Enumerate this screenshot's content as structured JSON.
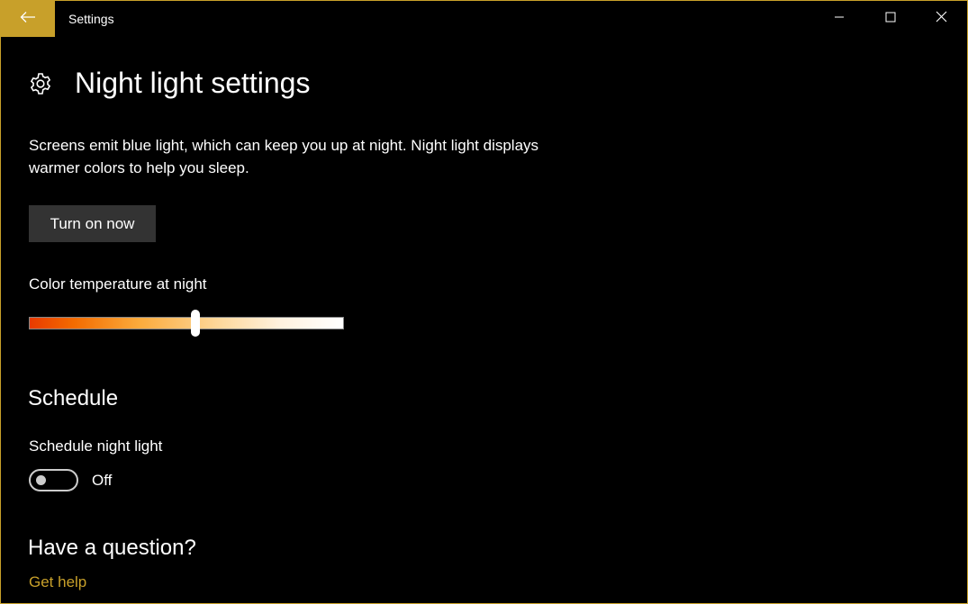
{
  "window": {
    "app_title": "Settings",
    "accent_color": "#c8a02a",
    "controls": {
      "minimize_icon": "minimize-icon",
      "maximize_icon": "maximize-icon",
      "close_icon": "close-icon"
    }
  },
  "header": {
    "back_icon": "back-arrow-icon",
    "page_icon": "gear-icon",
    "title": "Night light settings"
  },
  "main": {
    "description": "Screens emit blue light, which can keep you up at night. Night light displays warmer colors to help you sleep.",
    "turn_on_button": "Turn on now",
    "color_temperature": {
      "label": "Color temperature at night",
      "value_fraction": 0.53
    },
    "schedule": {
      "heading": "Schedule",
      "toggle_label": "Schedule night light",
      "toggle_state": "Off",
      "toggle_on": false
    },
    "help": {
      "heading": "Have a question?",
      "link": "Get help"
    }
  }
}
